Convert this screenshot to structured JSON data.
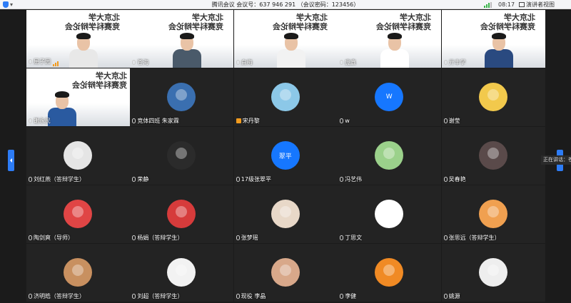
{
  "titlebar": {
    "title": "腾讯会议 会议号：637 946 291  （会议密码：123456）",
    "time": "08:17",
    "speaker_view_label": "演讲者视图",
    "signal_color": "#3ab54a"
  },
  "speaking": {
    "text": "正在讲话：苍海"
  },
  "video_banner": "北京大学\n竞赛科学辩论会",
  "tiles": [
    {
      "name": "屈子园",
      "kind": "video",
      "bars": true
    },
    {
      "name": "苍海",
      "kind": "video",
      "active": true
    },
    {
      "name": "白梅",
      "kind": "video"
    },
    {
      "name": "庞鑫",
      "kind": "video"
    },
    {
      "name": "亓丰学",
      "kind": "video"
    },
    {
      "name": "谢永民",
      "kind": "video"
    },
    {
      "name": "竞体四班 朱家霖",
      "kind": "avatar",
      "color": "#3a6fb0"
    },
    {
      "name": "宋丹黎",
      "kind": "avatar",
      "color": "#8cc8e8",
      "icon": "person-icon"
    },
    {
      "name": "w",
      "kind": "letter",
      "letter": "W",
      "color": "#1677ff"
    },
    {
      "name": "谢莹",
      "kind": "avatar",
      "color": "#f2c94c"
    },
    {
      "name": "刘红燕（答辩学生）",
      "kind": "avatar",
      "color": "#e5e5e5"
    },
    {
      "name": "荣静",
      "kind": "avatar",
      "color": "#2b2b2b"
    },
    {
      "name": "17级张翠平",
      "kind": "letter",
      "letter": "翠平",
      "color": "#1677ff"
    },
    {
      "name": "冯艺伟",
      "kind": "avatar",
      "color": "#9bd18b"
    },
    {
      "name": "吴春艳",
      "kind": "avatar",
      "color": "#5a4a4a"
    },
    {
      "name": "陶剑爽（导师）",
      "kind": "avatar",
      "color": "#e04545"
    },
    {
      "name": "杨娟（答辩学生）",
      "kind": "avatar",
      "color": "#d63b3b"
    },
    {
      "name": "张梦瑶",
      "kind": "avatar",
      "color": "#e8d8c8"
    },
    {
      "name": "丁思文",
      "kind": "avatar",
      "color": "#ffffff"
    },
    {
      "name": "张思远（答辩学生）",
      "kind": "avatar",
      "color": "#f0a050"
    },
    {
      "name": "济明皓（答辩学生）",
      "kind": "avatar",
      "color": "#c89060"
    },
    {
      "name": "刘超（答辩学生）",
      "kind": "avatar",
      "color": "#f2f2f2"
    },
    {
      "name": "现役 李晶",
      "kind": "avatar",
      "color": "#d8a88a"
    },
    {
      "name": "李健",
      "kind": "avatar",
      "color": "#f08a24"
    },
    {
      "name": "姚源",
      "kind": "avatar",
      "color": "#eeeeee"
    }
  ]
}
